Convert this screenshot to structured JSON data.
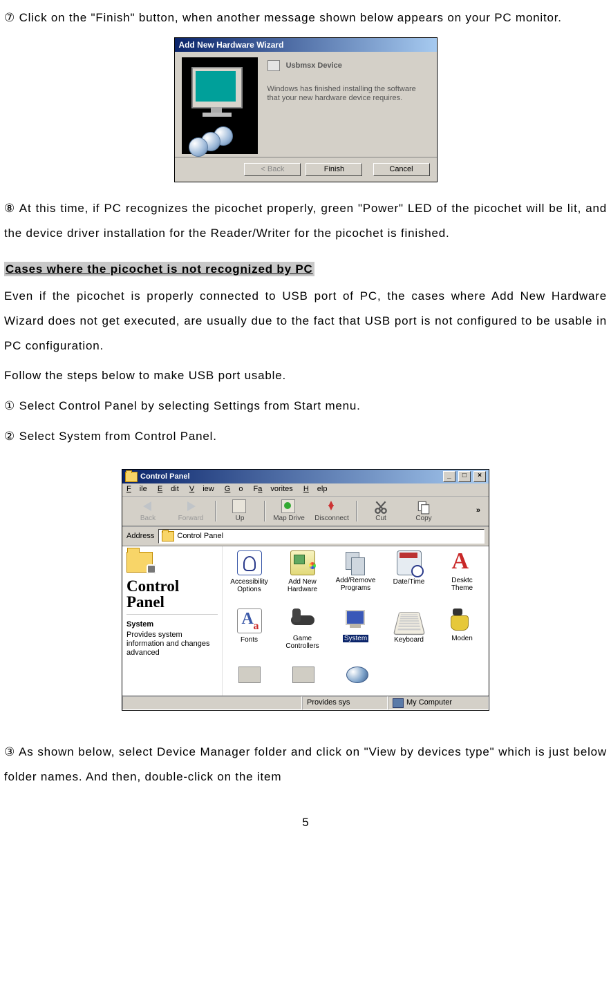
{
  "doc": {
    "step7": "⑦ Click on the \"Finish\" button, when another message shown below appears on your PC monitor.",
    "step8": "⑧ At this time, if PC recognizes the picochet properly, green \"Power\" LED of the picochet will be lit, and the device driver installation for the Reader/Writer for the picochet is finished.",
    "heading": "Cases where the picochet is not recognized by PC",
    "p1": "Even if the picochet is properly connected to USB port of PC, the cases where Add New Hardware Wizard does not get executed, are usually due to the fact that USB port is not configured to be usable in PC configuration.",
    "p2": "Follow the steps below to make USB port usable.",
    "s1": "① Select Control Panel by selecting Settings from Start menu.",
    "s2": "② Select System from Control Panel.",
    "s3": "③ As shown below, select Device Manager folder and click on \"View by devices type\" which is just below folder names. And then, double-click on the item",
    "page": "5"
  },
  "wizard": {
    "title": "Add New Hardware Wizard",
    "device": "Usbmsx Device",
    "message": "Windows has finished installing the software that your new hardware device requires.",
    "btn_back": "< Back",
    "btn_finish": "Finish",
    "btn_cancel": "Cancel"
  },
  "cp": {
    "title": "Control Panel",
    "menu": {
      "file": "File",
      "edit": "Edit",
      "view": "View",
      "go": "Go",
      "fav": "Favorites",
      "help": "Help"
    },
    "toolbar": {
      "back": "Back",
      "forward": "Forward",
      "up": "Up",
      "mapdrive": "Map Drive",
      "disconnect": "Disconnect",
      "cut": "Cut",
      "copy": "Copy"
    },
    "address_label": "Address",
    "address_value": "Control Panel",
    "left": {
      "title": "Control Panel",
      "subject": "System",
      "desc": "Provides system information and changes advanced"
    },
    "icons": {
      "r1": {
        "a": "Accessibility\nOptions",
        "b": "Add New\nHardware",
        "c": "Add/Remove\nPrograms",
        "d": "Date/Time",
        "e": "Desktc\nTheme"
      },
      "r2": {
        "a": "Fonts",
        "b": "Game\nControllers",
        "c": "System",
        "d": "Keyboard",
        "e": "Moden"
      }
    },
    "status": {
      "left": "",
      "mid": "Provides sys",
      "right": "My Computer"
    }
  }
}
